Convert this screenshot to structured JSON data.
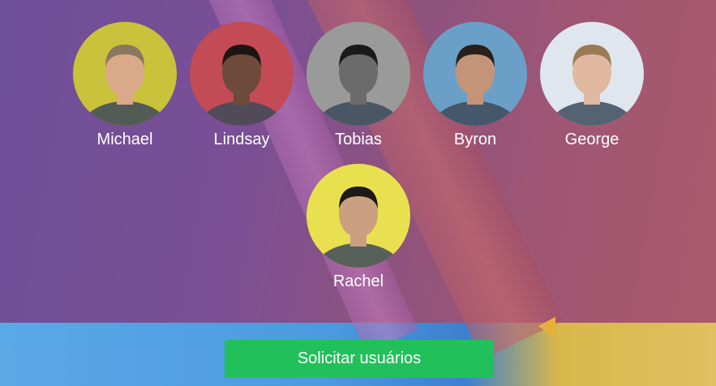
{
  "users": [
    {
      "name": "Michael",
      "avatar_bg": "#c9c23a",
      "skin": "#d9a98a",
      "hair": "#8a7760"
    },
    {
      "name": "Lindsay",
      "avatar_bg": "#c24b55",
      "skin": "#6e4a3a",
      "hair": "#1c1612"
    },
    {
      "name": "Tobias",
      "avatar_bg": "#9a9a9a",
      "skin": "#6b6b6b",
      "hair": "#1a1a1a"
    },
    {
      "name": "Byron",
      "avatar_bg": "#6aa0c8",
      "skin": "#c49478",
      "hair": "#2a1f1a"
    },
    {
      "name": "George",
      "avatar_bg": "#dfe6ee",
      "skin": "#e0b8a0",
      "hair": "#9a7b54"
    },
    {
      "name": "Rachel",
      "avatar_bg": "#e9e050",
      "skin": "#caa080",
      "hair": "#1e1a18"
    }
  ],
  "actions": {
    "request_users_label": "Solicitar usuários"
  },
  "colors": {
    "button": "#22c05a",
    "overlay": "#7a4f95"
  }
}
